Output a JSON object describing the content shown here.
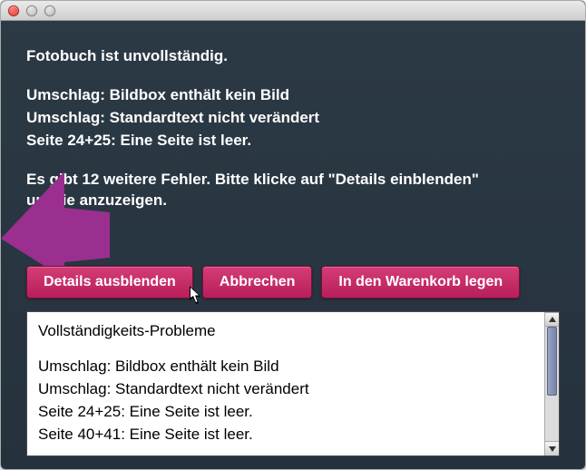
{
  "titlebar": {},
  "dialog": {
    "heading": "Fotobuch ist unvollständig.",
    "summary_lines": [
      "Umschlag: Bildbox enthält kein Bild",
      "Umschlag: Standardtext nicht verändert",
      "Seite 24+25: Eine Seite ist leer."
    ],
    "more_errors": "Es gibt 12 weitere Fehler. Bitte klicke auf \"Details einblenden\" um sie anzuzeigen."
  },
  "buttons": {
    "toggle_details": "Details ausblenden",
    "cancel": "Abbrechen",
    "add_to_cart": "In den Warenkorb legen"
  },
  "details": {
    "title": "Vollständigkeits-Probleme",
    "lines": [
      "Umschlag: Bildbox enthält kein Bild",
      "Umschlag: Standardtext nicht verändert",
      "Seite 24+25: Eine Seite ist leer.",
      "Seite 40+41: Eine Seite ist leer."
    ]
  },
  "colors": {
    "accent": "#c12a63",
    "arrow": "#9a2f8f",
    "window_bg": "#29363f"
  }
}
